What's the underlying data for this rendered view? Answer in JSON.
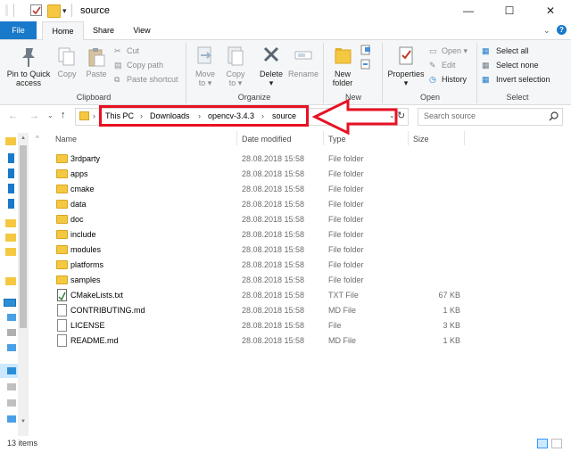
{
  "titlebar": {
    "title": "source",
    "minimize": "—",
    "maximize": "☐",
    "close": "✕"
  },
  "tabs": [
    {
      "label": "File",
      "active": false,
      "primary": true
    },
    {
      "label": "Home",
      "active": true
    },
    {
      "label": "Share",
      "active": false
    },
    {
      "label": "View",
      "active": false
    }
  ],
  "ribbon": {
    "clipboard": {
      "group": "Clipboard",
      "pin": "Pin to Quick access",
      "pin_l1": "Pin to Quick",
      "pin_l2": "access",
      "copy": "Copy",
      "paste": "Paste",
      "cut": "Cut",
      "copy_path": "Copy path",
      "paste_shortcut": "Paste shortcut"
    },
    "organize": {
      "group": "Organize",
      "move_to_l1": "Move",
      "move_to_l2": "to ▾",
      "copy_to_l1": "Copy",
      "copy_to_l2": "to ▾",
      "delete_l1": "Delete",
      "delete_l2": "▾",
      "rename": "Rename"
    },
    "new": {
      "group": "New",
      "new_folder_l1": "New",
      "new_folder_l2": "folder"
    },
    "open": {
      "group": "Open",
      "properties_l1": "Properties",
      "properties_l2": "▾",
      "open": "Open ▾",
      "edit": "Edit",
      "history": "History"
    },
    "select": {
      "group": "Select",
      "select_all": "Select all",
      "select_none": "Select none",
      "invert": "Invert selection"
    }
  },
  "nav": {
    "breadcrumb": [
      "This PC",
      "Downloads",
      "opencv-3.4.3",
      "source"
    ],
    "separator": "›",
    "search_placeholder": "Search source",
    "refresh": "↻"
  },
  "columns": {
    "name": "Name",
    "date": "Date modified",
    "type": "Type",
    "size": "Size"
  },
  "files": [
    {
      "name": "3rdparty",
      "date": "28.08.2018 15:58",
      "type": "File folder",
      "size": "",
      "kind": "folder"
    },
    {
      "name": "apps",
      "date": "28.08.2018 15:58",
      "type": "File folder",
      "size": "",
      "kind": "folder"
    },
    {
      "name": "cmake",
      "date": "28.08.2018 15:58",
      "type": "File folder",
      "size": "",
      "kind": "folder"
    },
    {
      "name": "data",
      "date": "28.08.2018 15:58",
      "type": "File folder",
      "size": "",
      "kind": "folder"
    },
    {
      "name": "doc",
      "date": "28.08.2018 15:58",
      "type": "File folder",
      "size": "",
      "kind": "folder"
    },
    {
      "name": "include",
      "date": "28.08.2018 15:58",
      "type": "File folder",
      "size": "",
      "kind": "folder"
    },
    {
      "name": "modules",
      "date": "28.08.2018 15:58",
      "type": "File folder",
      "size": "",
      "kind": "folder"
    },
    {
      "name": "platforms",
      "date": "28.08.2018 15:58",
      "type": "File folder",
      "size": "",
      "kind": "folder"
    },
    {
      "name": "samples",
      "date": "28.08.2018 15:58",
      "type": "File folder",
      "size": "",
      "kind": "folder"
    },
    {
      "name": "CMakeLists.txt",
      "date": "28.08.2018 15:58",
      "type": "TXT File",
      "size": "67 KB",
      "kind": "txt"
    },
    {
      "name": "CONTRIBUTING.md",
      "date": "28.08.2018 15:58",
      "type": "MD File",
      "size": "1 KB",
      "kind": "doc"
    },
    {
      "name": "LICENSE",
      "date": "28.08.2018 15:58",
      "type": "File",
      "size": "3 KB",
      "kind": "doc"
    },
    {
      "name": "README.md",
      "date": "28.08.2018 15:58",
      "type": "MD File",
      "size": "1 KB",
      "kind": "doc"
    }
  ],
  "status": {
    "count": "13 items"
  },
  "colors": {
    "accent": "#1979ca",
    "highlight": "#e81123",
    "folder": "#f5c842"
  }
}
